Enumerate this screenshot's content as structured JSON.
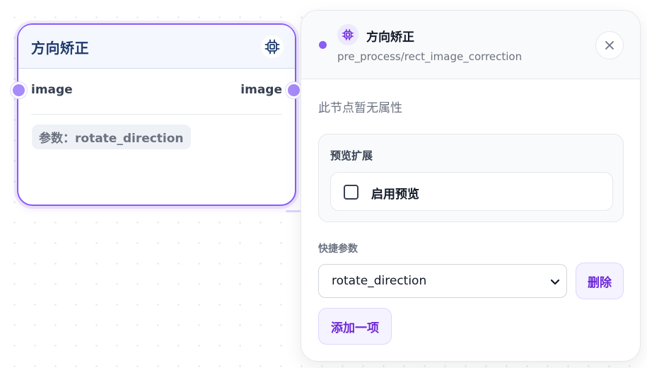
{
  "node": {
    "title": "方向矫正",
    "icon": "cpu-chip-icon",
    "input_label": "image",
    "output_label": "image",
    "param_chip": "参数：rotate_direction"
  },
  "panel": {
    "icon": "cpu-chip-icon",
    "title": "方向矫正",
    "path": "pre_process/rect_image_correction",
    "close_icon": "close-icon",
    "empty_note": "此节点暂无属性",
    "preview": {
      "title": "预览扩展",
      "toggle_label": "启用预览",
      "checked": false
    },
    "quick_params": {
      "label": "快捷参数",
      "selected": "rotate_direction",
      "delete_label": "删除",
      "add_label": "添加一项"
    }
  },
  "colors": {
    "accent": "#8b5cf6",
    "accent_dark": "#6d28d9",
    "accent_soft": "#f5f3ff",
    "node_title": "#1e3a6e"
  }
}
